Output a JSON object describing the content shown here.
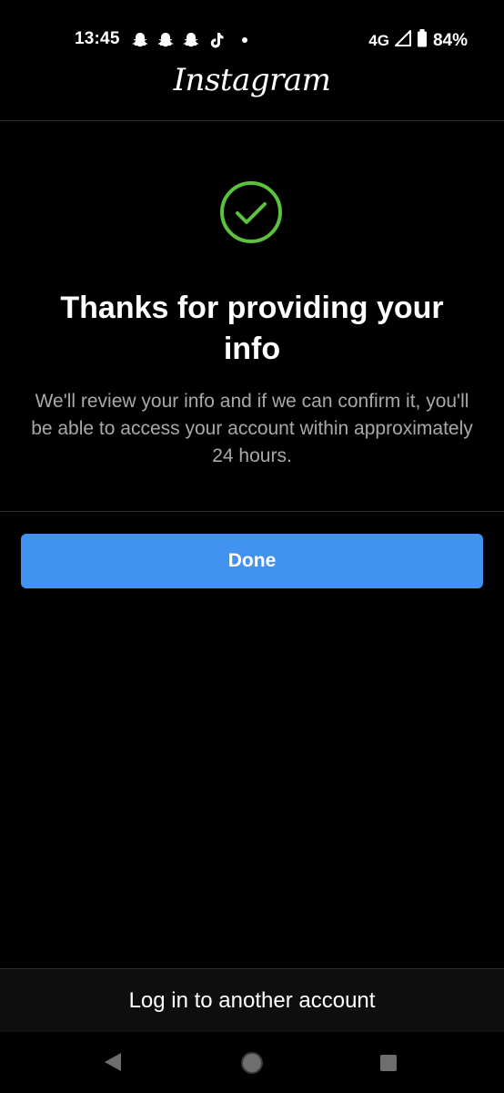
{
  "status_bar": {
    "time": "13:45",
    "network": "4G",
    "battery": "84%",
    "notification_icons": [
      "snapchat-icon",
      "snapchat-icon",
      "snapchat-icon",
      "tiktok-icon"
    ]
  },
  "header": {
    "logo": "Instagram"
  },
  "content": {
    "title": "Thanks for providing your info",
    "description": "We'll review your info and if we can confirm it, you'll be able to access your account within approximately 24 hours.",
    "done_label": "Done"
  },
  "footer": {
    "link_label": "Log in to another account"
  },
  "colors": {
    "background": "#000000",
    "button": "#4193ef",
    "check": "#5cc23d",
    "description": "#a8a8a8"
  }
}
